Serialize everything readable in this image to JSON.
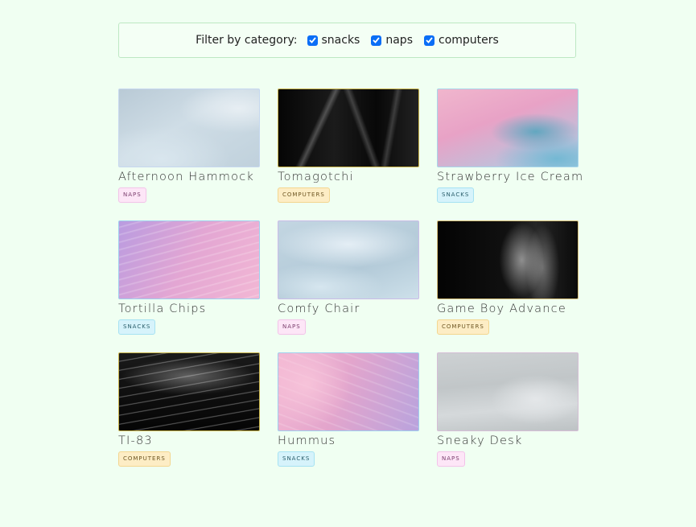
{
  "filter": {
    "label": "Filter by category:",
    "options": [
      {
        "label": "snacks",
        "checked": true
      },
      {
        "label": "naps",
        "checked": true
      },
      {
        "label": "computers",
        "checked": true
      }
    ]
  },
  "items": [
    {
      "title": "Afternoon Hammock",
      "category": "NAPS"
    },
    {
      "title": "Tomagotchi",
      "category": "COMPUTERS"
    },
    {
      "title": "Strawberry Ice Cream",
      "category": "SNACKS"
    },
    {
      "title": "Tortilla Chips",
      "category": "SNACKS"
    },
    {
      "title": "Comfy Chair",
      "category": "NAPS"
    },
    {
      "title": "Game Boy Advance",
      "category": "COMPUTERS"
    },
    {
      "title": "TI-83",
      "category": "COMPUTERS"
    },
    {
      "title": "Hummus",
      "category": "SNACKS"
    },
    {
      "title": "Sneaky Desk",
      "category": "NAPS"
    }
  ],
  "colors": {
    "background": "#f0fff2",
    "checkbox": "#0b6ef6",
    "tag_naps": "#fde6f7",
    "tag_computers": "#fdedc5",
    "tag_snacks": "#d6f3fb"
  }
}
